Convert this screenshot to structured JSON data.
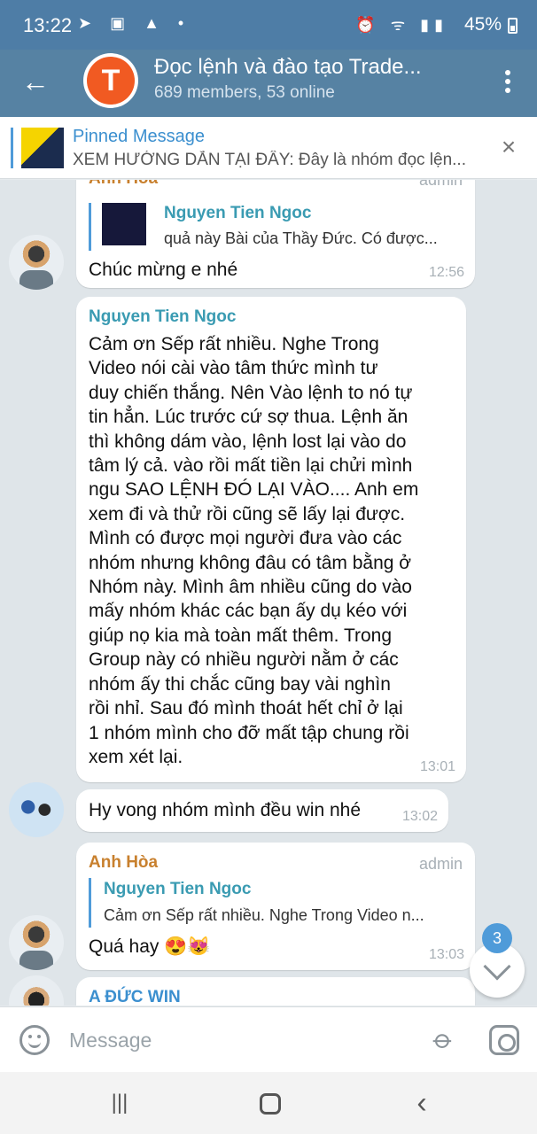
{
  "status_bar": {
    "time": "13:22",
    "left_icons": "➤ ▣ ▲ •",
    "right_icons": "⏰ ᯤ ▮▮",
    "battery": "45%"
  },
  "header": {
    "back_icon": "←",
    "avatar_letter": "T",
    "title": "Đọc lệnh và đào tạo Trade...",
    "subtitle": "689 members, 53 online",
    "menu_icon": "more-vertical-icon"
  },
  "pinned": {
    "title": "Pinned Message",
    "text": "XEM HƯỚNG DẪN TẠI ĐÂY: Đây là nhóm đọc lện...",
    "close_icon": "×"
  },
  "messages": [
    {
      "sender": "Anh Hòa",
      "role": "admin",
      "reply_name": "Nguyen Tien Ngoc",
      "reply_text": "quả này Bài của Thầy Đức. Có được...",
      "text": "Chúc mừng e nhé",
      "time": "12:56"
    },
    {
      "sender": "Nguyen Tien Ngoc",
      "lines": [
        "Cảm ơn Sếp rất nhiều. Nghe Trong",
        "Video nói cài vào tâm thức mình tư",
        "duy chiến thắng. Nên Vào lệnh to nó tự",
        "tin hẳn. Lúc trước cứ sợ thua. Lệnh ăn",
        "thì không dám vào, lệnh lost lại vào do",
        "tâm lý cả. vào rồi mất tiền lại chửi mình",
        "ngu SAO LỆNH ĐÓ LẠI VÀO.... Anh em",
        "xem đi và thử rồi cũng sẽ lấy lại được.",
        "Mình có được mọi người đưa vào các",
        "nhóm nhưng không đâu có tâm bằng ở",
        "Nhóm này. Mình âm nhiều cũng do vào",
        "mấy nhóm khác các bạn ấy dụ kéo với",
        "giúp nọ kia mà toàn mất thêm. Trong",
        "Group này có nhiều người nằm ở các",
        "nhóm ấy thi chắc cũng bay vài nghìn",
        "rồi nhỉ. Sau đó mình thoát hết chỉ ở lại",
        "1 nhóm mình cho đỡ mất tập chung rồi",
        "xem xét lại."
      ],
      "time": "13:01"
    },
    {
      "text": "Hy vong nhóm mình đều win nhé",
      "time": "13:02"
    },
    {
      "sender": "Anh Hòa",
      "role": "admin",
      "reply_name": "Nguyen Tien Ngoc",
      "reply_text": "Cảm ơn Sếp rất nhiều. Nghe Trong Video n...",
      "text": "Quá hay 😍😻",
      "time": "13:03"
    },
    {
      "sender": "A ĐỨC WIN"
    }
  ],
  "scroll": {
    "unread_count": "3"
  },
  "composer": {
    "placeholder": "Message"
  },
  "nav": {
    "recent_icon": "|||",
    "back_icon": "‹"
  }
}
